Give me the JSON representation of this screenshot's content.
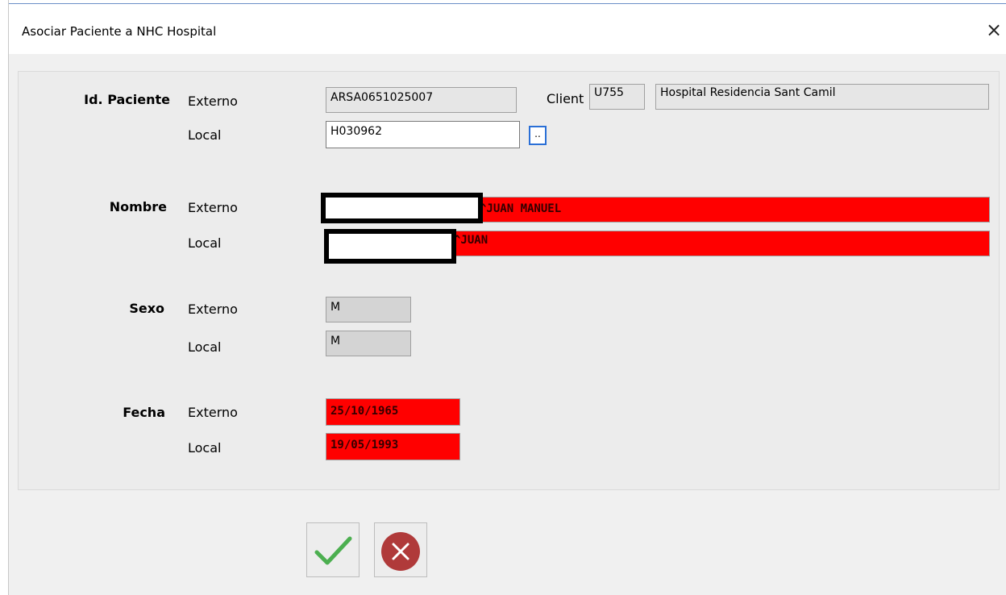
{
  "window": {
    "title": "Asociar Paciente a NHC Hospital",
    "close_symbol": "×"
  },
  "id_paciente": {
    "label": "Id. Paciente",
    "externo_label": "Externo",
    "local_label": "Local",
    "externo_value": "ARSA0651025007",
    "local_value": "H030962",
    "browse_label": "..",
    "client_label": "Client",
    "client_code": "U755",
    "client_name": "Hospital Residencia Sant Camil"
  },
  "nombre": {
    "label": "Nombre",
    "externo_label": "Externo",
    "local_label": "Local",
    "externo_value": "^JUAN MANUEL",
    "local_value": "^JUAN"
  },
  "sexo": {
    "label": "Sexo",
    "externo_label": "Externo",
    "local_label": "Local",
    "externo_value": "M",
    "local_value": "M"
  },
  "fecha": {
    "label": "Fecha",
    "externo_label": "Externo",
    "local_label": "Local",
    "externo_value": "25/10/1965",
    "local_value": "19/05/1993"
  },
  "colors": {
    "mismatch": "#ff0000",
    "accept": "#4caf50",
    "cancel": "#b03a3a",
    "browse_border": "#2a6fd6"
  },
  "icons": {
    "accept": "checkmark-icon",
    "cancel": "cancel-circle-icon",
    "close": "close-icon"
  }
}
